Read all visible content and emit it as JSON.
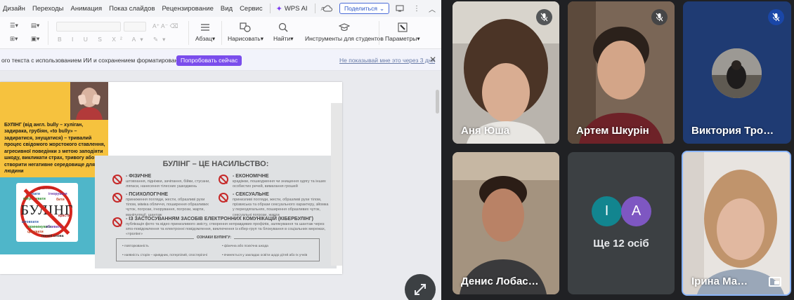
{
  "wps": {
    "menu": [
      "Дизайн",
      "Переходы",
      "Анимация",
      "Показ слайдов",
      "Рецензирование",
      "Вид",
      "Сервис"
    ],
    "wps_ai": "WPS AI",
    "share_label": "Поделиться",
    "ribbon": {
      "paragraph": "Абзац",
      "draw": "Нарисовать",
      "find": "Найти",
      "student_tools": "Инструменты для студентов",
      "params": "Параметры"
    },
    "banner": {
      "message": "ого текста с использованием ИИ и сохранением форматирования.",
      "try_button": "Попробовать сейчас",
      "dont_show": "Не показывай мне это через 3 дня"
    },
    "slide": {
      "definition": "БУЛІНГ (від англ. bully – хуліган, задирака, грубіян, «to bully» – задиратися, знущатися) – тривалий процес свідомого жорстокого ставлення, агресивної поведінки з метою заподіяти шкоду, викликати страх, тривогу або ж створити негативне середовище для людини",
      "stamp_word": "БУЛІНГ",
      "stamp_words": [
        "дражнити",
        "брехати",
        "ігнорувати",
        "погрожувати",
        "бити",
        "красти",
        "штовхати",
        "принижувати",
        "обзивати",
        "цькувати",
        "поганi слова"
      ],
      "panel_title": "БУЛІНГ – ЦЕ НАСИЛЬСТВО:",
      "types": [
        {
          "title": "- ФІЗИЧНЕ",
          "text": "штовхання, підніжки, зачіпання, бійки, стусани, ляпаси, нанесення тілесних ушкоджень"
        },
        {
          "title": "- ЕКОНОМІЧНЕ",
          "text": "крадіжки, пошкодження чи знищення одягу та інших особистих речей, вимагання грошей"
        },
        {
          "title": "- ПСИХОЛОГІЧНЕ",
          "text": "приниження погляди, жести, образливі рухи тілом, міміка обличчя, поширення образливих чуток, погрози, ігнорування, погрози, жарти, маніпуляції, шантаж"
        },
        {
          "title": "- СЕКСУАЛЬНЕ",
          "text": "принизливі погляди, жести, образливі рухи тілом, прізвиська та образи сексуального характеру, зйомка у переодягальнях, поширення образливих чуток, сексуальні погрози, жарти"
        },
        {
          "title": "- ІЗ ЗАСТОСУВАННЯМ ЗАСОБІВ ЕЛЕКТРОННИХ КОМУНІКАЦІЙ (КІБЕРБУЛІНГ)",
          "text": "публікація фото та відео принизливого змісту, створення неправдивих профілів, залякування та шантаж через sms-повідомлення та електронні повідомлення, виключення із кібер-груп та блокування в соціальних мережах, «тролінг»"
        }
      ],
      "signs_title": "ОЗНАКИ БУЛІНГУ:",
      "signs": [
        "повторюваність",
        "фізична або психічна шкода",
        "наявність сторін – кривдник, потерпілий, спостерігачі",
        "вчиняється у закладах освіти щодо дітей або їх учнів"
      ]
    }
  },
  "meet": {
    "participants": [
      {
        "name": "Аня Юша",
        "muted": true
      },
      {
        "name": "Артем Шкурін",
        "muted": true
      },
      {
        "name": "Виктория Тро…",
        "muted": true
      },
      {
        "name": "Денис Лобас…",
        "muted": false
      },
      {
        "name": "Ірина Ма…",
        "muted": false
      }
    ],
    "others": {
      "label": "Ще 12 осіб",
      "avatars": [
        {
          "letter": "I",
          "color": "#12858f"
        },
        {
          "letter": "A",
          "color": "#7e57c2"
        }
      ]
    }
  }
}
